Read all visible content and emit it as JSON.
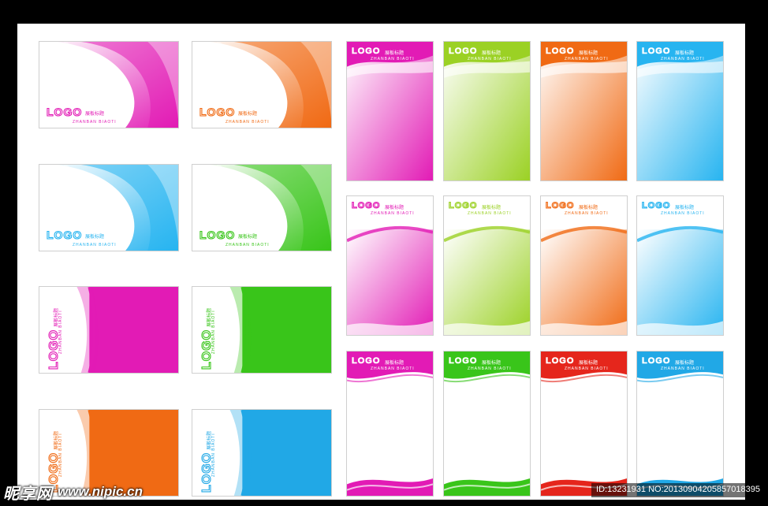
{
  "colors": {
    "magenta": "#e21bb5",
    "orange": "#f06a14",
    "cyan": "#27b4f0",
    "green": "#39c51a",
    "lime": "#9bd124",
    "yellow": "#f7d80c",
    "red": "#e5261c",
    "sky": "#21a8e6"
  },
  "cards": [
    {
      "style": "h-wave",
      "color": "magenta",
      "logo": "LOGO",
      "cn": "展板标题",
      "py": "ZHANBAN BIAOTI"
    },
    {
      "style": "h-wave",
      "color": "orange",
      "logo": "LOGO",
      "cn": "展板标题",
      "py": "ZHANBAN BIAOTI"
    },
    {
      "style": "h-wave",
      "color": "cyan",
      "logo": "LOGO",
      "cn": "展板标题",
      "py": "ZHANBAN BIAOTI"
    },
    {
      "style": "h-wave",
      "color": "green",
      "logo": "LOGO",
      "cn": "展板标题",
      "py": "ZHANBAN BIAOTI"
    },
    {
      "style": "h-side",
      "color": "magenta",
      "logo": "LOGO",
      "cn": "展板标题",
      "py": "ZHANBAN BIAOTI"
    },
    {
      "style": "h-side",
      "color": "green",
      "logo": "LOGO",
      "cn": "展板标题",
      "py": "ZHANBAN BIAOTI"
    },
    {
      "style": "h-side",
      "color": "orange",
      "logo": "LOGO",
      "cn": "展板标题",
      "py": "ZHANBAN BIAOTI"
    },
    {
      "style": "h-side",
      "color": "sky",
      "logo": "LOGO",
      "cn": "展板标题",
      "py": "ZHANBAN BIAOTI"
    },
    {
      "style": "v-grad",
      "color": "magenta",
      "logo": "LOGO",
      "cn": "展板标题",
      "py": "ZHANBAN BIAOTI"
    },
    {
      "style": "v-grad",
      "color": "lime",
      "logo": "LOGO",
      "cn": "展板标题",
      "py": "ZHANBAN BIAOTI"
    },
    {
      "style": "v-grad",
      "color": "orange",
      "logo": "LOGO",
      "cn": "展板标题",
      "py": "ZHANBAN BIAOTI"
    },
    {
      "style": "v-grad",
      "color": "cyan",
      "logo": "LOGO",
      "cn": "展板标题",
      "py": "ZHANBAN BIAOTI"
    },
    {
      "style": "v-wave",
      "color": "magenta",
      "logo": "LOGO",
      "cn": "展板标题",
      "py": "ZHANBAN BIAOTI"
    },
    {
      "style": "v-wave",
      "color": "lime",
      "logo": "LOGO",
      "cn": "展板标题",
      "py": "ZHANBAN BIAOTI"
    },
    {
      "style": "v-wave",
      "color": "orange",
      "logo": "LOGO",
      "cn": "展板标题",
      "py": "ZHANBAN BIAOTI"
    },
    {
      "style": "v-wave",
      "color": "cyan",
      "logo": "LOGO",
      "cn": "展板标题",
      "py": "ZHANBAN BIAOTI"
    },
    {
      "style": "v-header",
      "color": "magenta",
      "logo": "LOGO",
      "cn": "展板标题",
      "py": "ZHANBAN BIAOTI"
    },
    {
      "style": "v-header",
      "color": "green",
      "logo": "LOGO",
      "cn": "展板标题",
      "py": "ZHANBAN BIAOTI"
    },
    {
      "style": "v-header",
      "color": "red",
      "logo": "LOGO",
      "cn": "展板标题",
      "py": "ZHANBAN BIAOTI"
    },
    {
      "style": "v-header",
      "color": "sky",
      "logo": "LOGO",
      "cn": "展板标题",
      "py": "ZHANBAN BIAOTI"
    }
  ],
  "watermark": {
    "site_name": "昵享网",
    "url": "www.nipic.cn",
    "id_text": "ID:13231931 NO:20130904205857018395"
  }
}
